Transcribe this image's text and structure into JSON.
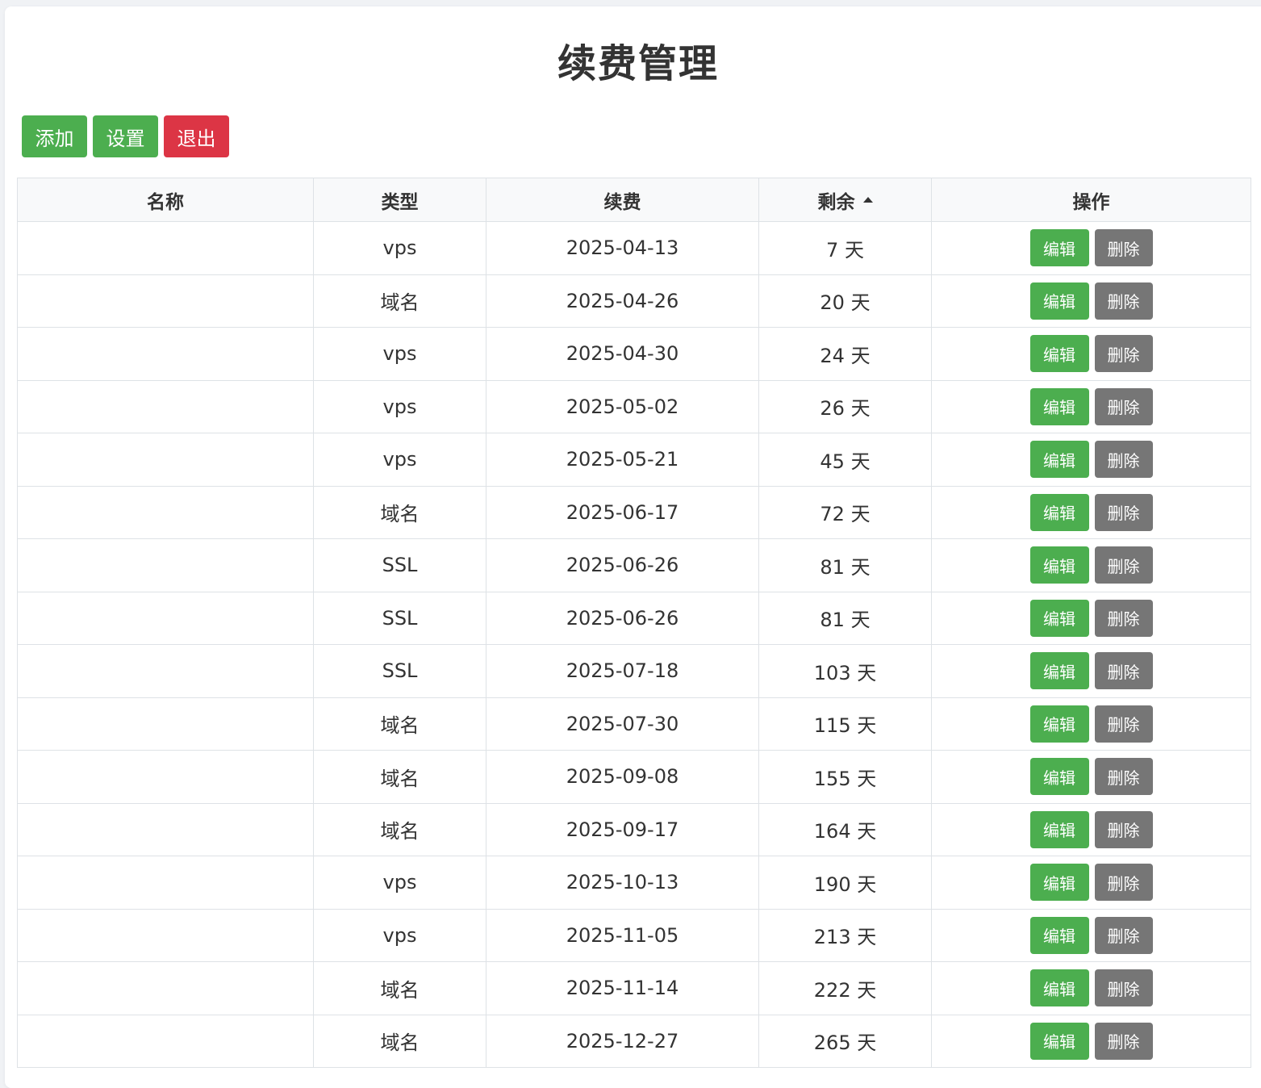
{
  "page": {
    "title": "续费管理"
  },
  "toolbar": {
    "add_label": "添加",
    "settings_label": "设置",
    "logout_label": "退出"
  },
  "table": {
    "headers": {
      "name": "名称",
      "type": "类型",
      "renew": "续费",
      "remaining": "剩余",
      "actions": "操作"
    },
    "sort": {
      "column": "remaining",
      "direction": "ascending"
    },
    "edit_label": "编辑",
    "delete_label": "删除",
    "rows": [
      {
        "name": "",
        "type": "vps",
        "renew": "2025-04-13",
        "remaining": "7 天"
      },
      {
        "name": "",
        "type": "域名",
        "renew": "2025-04-26",
        "remaining": "20 天"
      },
      {
        "name": "",
        "type": "vps",
        "renew": "2025-04-30",
        "remaining": "24 天"
      },
      {
        "name": "",
        "type": "vps",
        "renew": "2025-05-02",
        "remaining": "26 天"
      },
      {
        "name": "",
        "type": "vps",
        "renew": "2025-05-21",
        "remaining": "45 天"
      },
      {
        "name": "",
        "type": "域名",
        "renew": "2025-06-17",
        "remaining": "72 天"
      },
      {
        "name": "",
        "type": "SSL",
        "renew": "2025-06-26",
        "remaining": "81 天"
      },
      {
        "name": "",
        "type": "SSL",
        "renew": "2025-06-26",
        "remaining": "81 天"
      },
      {
        "name": "",
        "type": "SSL",
        "renew": "2025-07-18",
        "remaining": "103 天"
      },
      {
        "name": "",
        "type": "域名",
        "renew": "2025-07-30",
        "remaining": "115 天"
      },
      {
        "name": "",
        "type": "域名",
        "renew": "2025-09-08",
        "remaining": "155 天"
      },
      {
        "name": "",
        "type": "域名",
        "renew": "2025-09-17",
        "remaining": "164 天"
      },
      {
        "name": "",
        "type": "vps",
        "renew": "2025-10-13",
        "remaining": "190 天"
      },
      {
        "name": "",
        "type": "vps",
        "renew": "2025-11-05",
        "remaining": "213 天"
      },
      {
        "name": "",
        "type": "域名",
        "renew": "2025-11-14",
        "remaining": "222 天"
      },
      {
        "name": "",
        "type": "域名",
        "renew": "2025-12-27",
        "remaining": "265 天"
      }
    ]
  },
  "colors": {
    "primary_green": "#4cae4f",
    "danger_red": "#dc3545",
    "secondary_gray": "#767676"
  }
}
